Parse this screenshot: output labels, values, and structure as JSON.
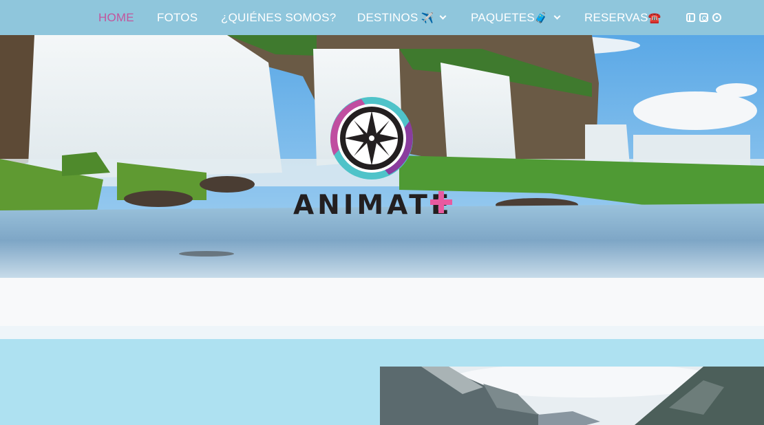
{
  "nav": {
    "items": [
      {
        "label": "HOME",
        "active": true
      },
      {
        "label": "FOTOS"
      },
      {
        "label": "¿QUIÉNES SOMOS?"
      },
      {
        "label": "DESTINOS",
        "emoji": "✈️",
        "dropdown": true
      },
      {
        "label": "PAQUETES",
        "emoji": "🧳",
        "dropdown": true
      },
      {
        "label": "RESERVAS",
        "emoji": "☎️"
      }
    ],
    "social_icons": [
      "facebook-icon",
      "instagram-icon",
      "whatsapp-icon"
    ]
  },
  "hero": {
    "logo_text": "ANIMATE",
    "logo_mark": "compass-rose-icon"
  },
  "colors": {
    "nav_bg": "#8fc6dc",
    "active": "#c2559c",
    "section_bg": "#aee1f1",
    "logo_plus": "#e85aa0"
  }
}
